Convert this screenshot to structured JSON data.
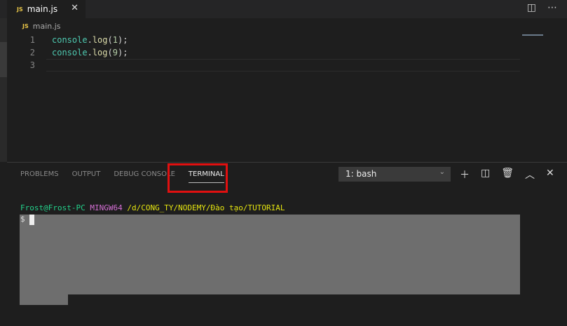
{
  "editor": {
    "tab_label": "main.js",
    "tab_icon": "JS",
    "breadcrumb": "main.js",
    "lines": [
      {
        "n": "1",
        "obj": "console",
        "dot": ".",
        "fn": "log",
        "open": "(",
        "arg": "1",
        "close": ");"
      },
      {
        "n": "2",
        "obj": "console",
        "dot": ".",
        "fn": "log",
        "open": "(",
        "arg": "9",
        "close": ");"
      },
      {
        "n": "3"
      }
    ]
  },
  "panel": {
    "tabs": [
      "PROBLEMS",
      "OUTPUT",
      "DEBUG CONSOLE",
      "TERMINAL"
    ],
    "active_tab": "TERMINAL",
    "terminal_select": "1: bash"
  },
  "terminal": {
    "user": "Frost@Frost-PC",
    "env": "MINGW64",
    "path": "/d/CONG_TY/NODEMY/Đào tạo/TUTORIAL",
    "prompt": "$"
  },
  "colors": {
    "highlight": "#e01010",
    "accent_green": "#23d18b"
  }
}
